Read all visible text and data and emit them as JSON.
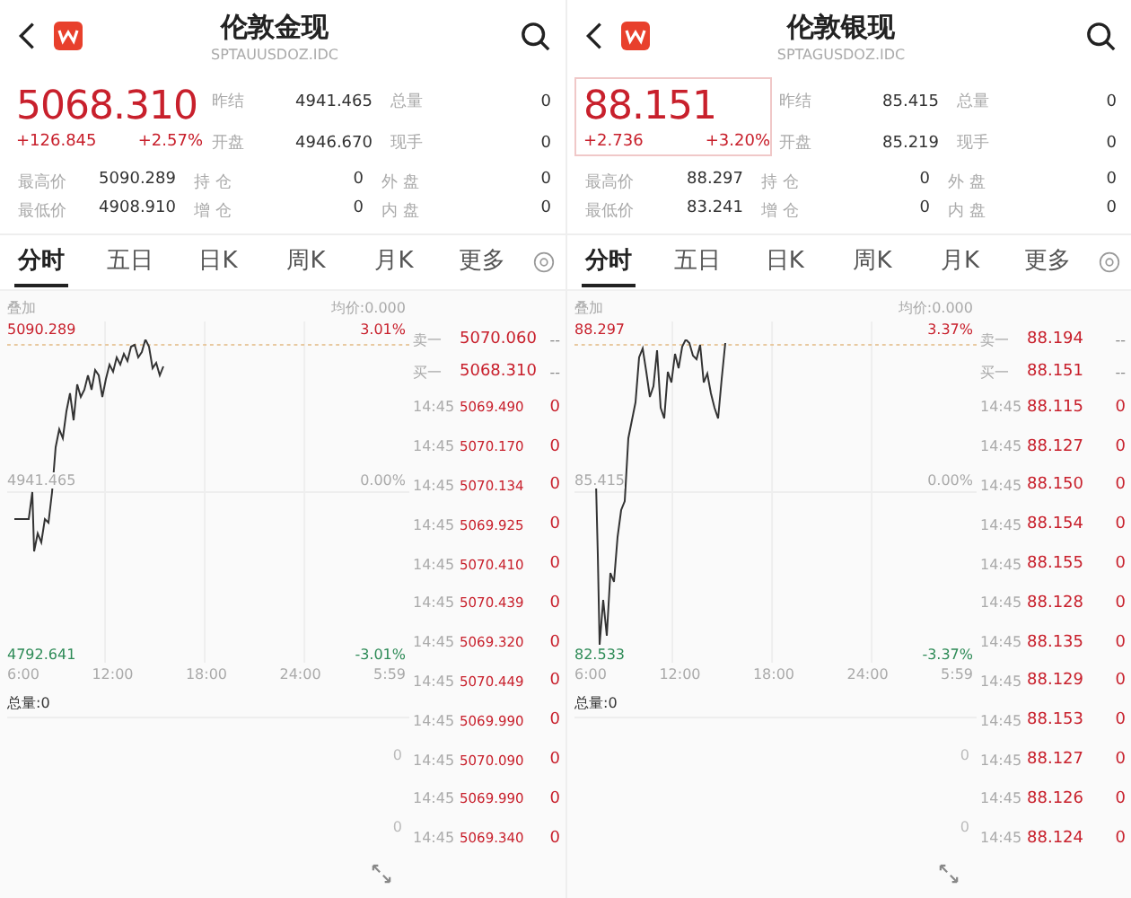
{
  "panels": [
    {
      "title": "伦敦金现",
      "code": "SPTAUUSDOZ.IDC",
      "price": "5068.310",
      "change": "+126.845",
      "change_pct": "+2.57%",
      "price_highlighted": false,
      "stats_top": [
        [
          {
            "label": "昨结",
            "value": "4941.465"
          },
          {
            "label": "总量",
            "value": "0"
          }
        ],
        [
          {
            "label": "开盘",
            "value": "4946.670"
          },
          {
            "label": "现手",
            "value": "0"
          }
        ]
      ],
      "stats_bottom": [
        [
          {
            "label": "最高价",
            "value": "5090.289"
          },
          {
            "label": "持 仓",
            "value": "0"
          },
          {
            "label": "外 盘",
            "value": "0"
          }
        ],
        [
          {
            "label": "最低价",
            "value": "4908.910"
          },
          {
            "label": "增 仓",
            "value": "0"
          },
          {
            "label": "内 盘",
            "value": "0"
          }
        ]
      ],
      "tabs": [
        {
          "label": "分时",
          "selected": true
        },
        {
          "label": "五日",
          "selected": false
        },
        {
          "label": "日K",
          "selected": false
        },
        {
          "label": "周K",
          "selected": false
        },
        {
          "label": "月K",
          "selected": false
        },
        {
          "label": "更多",
          "selected": false
        }
      ],
      "chart": {
        "overlay": "叠加",
        "average": "均价:0.000",
        "high": "5090.289",
        "high_pct": "3.01%",
        "base": "4941.465",
        "base_pct": "0.00%",
        "low": "4792.641",
        "low_pct": "-3.01%",
        "x_labels": [
          "6:00",
          "12:00",
          "18:00",
          "24:00",
          "5:59"
        ]
      },
      "volume": {
        "total": "总量:0",
        "ticks": [
          "0",
          "0"
        ]
      },
      "order_book": [
        {
          "label": "卖一",
          "price": "5070.060",
          "volume": "--"
        },
        {
          "label": "买一",
          "price": "5068.310",
          "volume": "--"
        }
      ],
      "trades": [
        {
          "time": "14:45",
          "price": "5069.490",
          "volume": "0"
        },
        {
          "time": "14:45",
          "price": "5070.170",
          "volume": "0"
        },
        {
          "time": "14:45",
          "price": "5070.134",
          "volume": "0"
        },
        {
          "time": "14:45",
          "price": "5069.925",
          "volume": "0"
        },
        {
          "time": "14:45",
          "price": "5070.410",
          "volume": "0"
        },
        {
          "time": "14:45",
          "price": "5070.439",
          "volume": "0"
        },
        {
          "time": "14:45",
          "price": "5069.320",
          "volume": "0"
        },
        {
          "time": "14:45",
          "price": "5070.449",
          "volume": "0"
        },
        {
          "time": "14:45",
          "price": "5069.990",
          "volume": "0"
        },
        {
          "time": "14:45",
          "price": "5070.090",
          "volume": "0"
        },
        {
          "time": "14:45",
          "price": "5069.990",
          "volume": "0"
        },
        {
          "time": "14:45",
          "price": "5069.340",
          "volume": "0"
        }
      ]
    },
    {
      "title": "伦敦银现",
      "code": "SPTAGUSDOZ.IDC",
      "price": "88.151",
      "change": "+2.736",
      "change_pct": "+3.20%",
      "price_highlighted": true,
      "stats_top": [
        [
          {
            "label": "昨结",
            "value": "85.415"
          },
          {
            "label": "总量",
            "value": "0"
          }
        ],
        [
          {
            "label": "开盘",
            "value": "85.219"
          },
          {
            "label": "现手",
            "value": "0"
          }
        ]
      ],
      "stats_bottom": [
        [
          {
            "label": "最高价",
            "value": "88.297"
          },
          {
            "label": "持 仓",
            "value": "0"
          },
          {
            "label": "外 盘",
            "value": "0"
          }
        ],
        [
          {
            "label": "最低价",
            "value": "83.241"
          },
          {
            "label": "增 仓",
            "value": "0"
          },
          {
            "label": "内 盘",
            "value": "0"
          }
        ]
      ],
      "tabs": [
        {
          "label": "分时",
          "selected": true
        },
        {
          "label": "五日",
          "selected": false
        },
        {
          "label": "日K",
          "selected": false
        },
        {
          "label": "周K",
          "selected": false
        },
        {
          "label": "月K",
          "selected": false
        },
        {
          "label": "更多",
          "selected": false
        }
      ],
      "chart": {
        "overlay": "叠加",
        "average": "均价:0.000",
        "high": "88.297",
        "high_pct": "3.37%",
        "base": "85.415",
        "base_pct": "0.00%",
        "low": "82.533",
        "low_pct": "-3.37%",
        "x_labels": [
          "6:00",
          "12:00",
          "18:00",
          "24:00",
          "5:59"
        ]
      },
      "volume": {
        "total": "总量:0",
        "ticks": [
          "0",
          "0"
        ]
      },
      "order_book": [
        {
          "label": "卖一",
          "price": "88.194",
          "volume": "--"
        },
        {
          "label": "买一",
          "price": "88.151",
          "volume": "--"
        }
      ],
      "trades": [
        {
          "time": "14:45",
          "price": "88.115",
          "volume": "0"
        },
        {
          "time": "14:45",
          "price": "88.127",
          "volume": "0"
        },
        {
          "time": "14:45",
          "price": "88.150",
          "volume": "0"
        },
        {
          "time": "14:45",
          "price": "88.154",
          "volume": "0"
        },
        {
          "time": "14:45",
          "price": "88.155",
          "volume": "0"
        },
        {
          "time": "14:45",
          "price": "88.128",
          "volume": "0"
        },
        {
          "time": "14:45",
          "price": "88.135",
          "volume": "0"
        },
        {
          "time": "14:45",
          "price": "88.129",
          "volume": "0"
        },
        {
          "time": "14:45",
          "price": "88.153",
          "volume": "0"
        },
        {
          "time": "14:45",
          "price": "88.127",
          "volume": "0"
        },
        {
          "time": "14:45",
          "price": "88.126",
          "volume": "0"
        },
        {
          "time": "14:45",
          "price": "88.124",
          "volume": "0"
        }
      ]
    }
  ]
}
